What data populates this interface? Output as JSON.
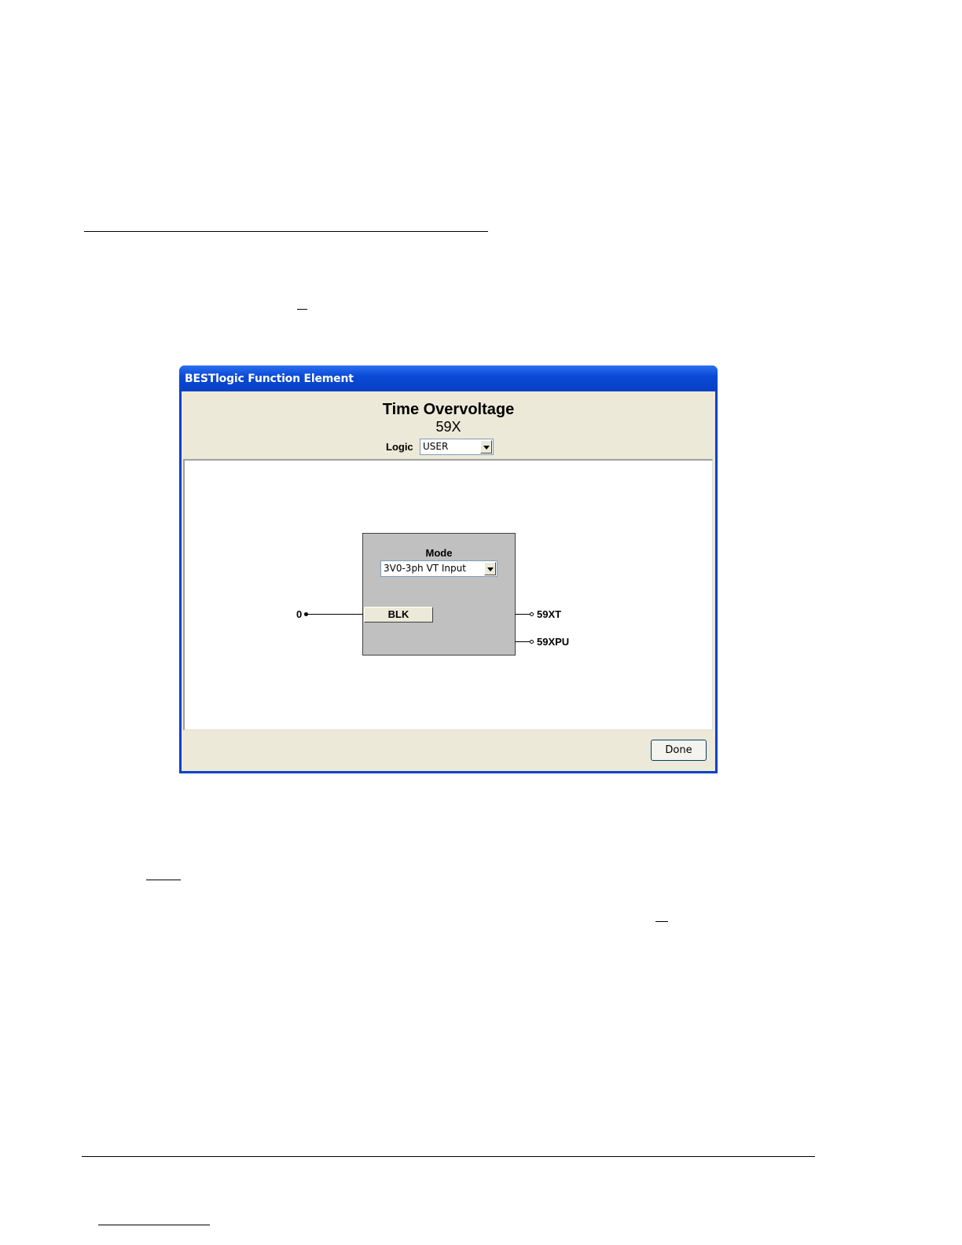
{
  "dialog": {
    "title": "BESTlogic Function Element",
    "heading": "Time Overvoltage",
    "element_id": "59X",
    "logic_label": "Logic",
    "logic_value": "USER",
    "mode_label": "Mode",
    "mode_value": "3V0-3ph VT Input",
    "input_value": "0",
    "blk_label": "BLK",
    "output_trip": "59XT",
    "output_pickup": "59XPU",
    "done_label": "Done"
  }
}
